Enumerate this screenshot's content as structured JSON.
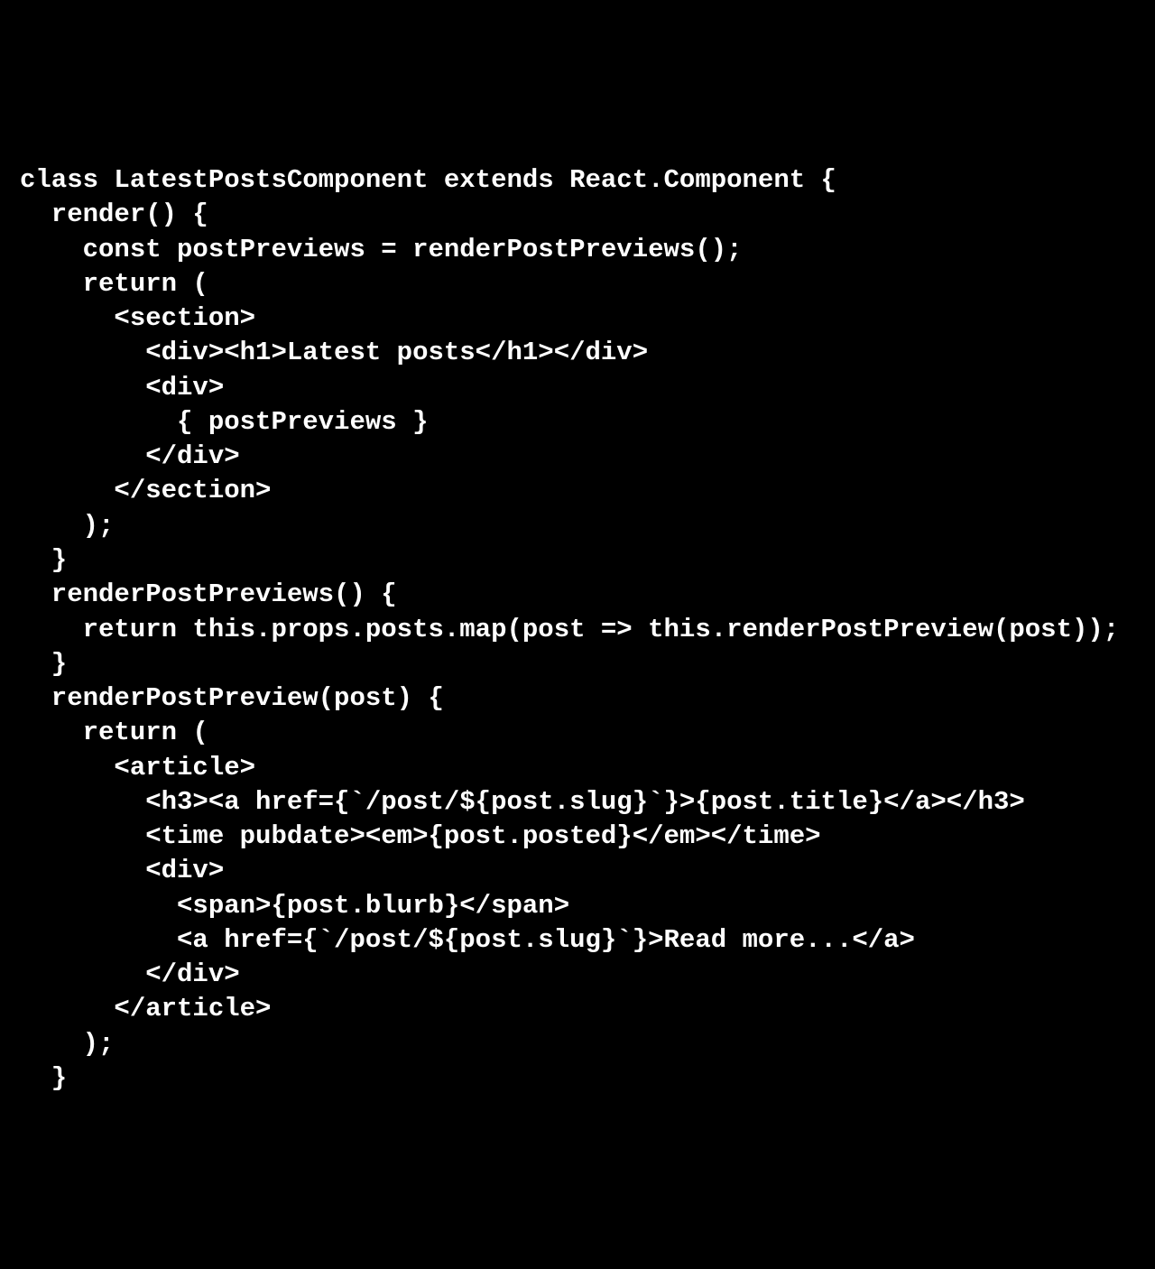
{
  "code": {
    "lines": [
      "class LatestPostsComponent extends React.Component {",
      "  render() {",
      "    const postPreviews = renderPostPreviews();",
      "    return (",
      "      <section>",
      "        <div><h1>Latest posts</h1></div>",
      "        <div>",
      "          { postPreviews }",
      "        </div>",
      "      </section>",
      "    );",
      "  }",
      "  renderPostPreviews() {",
      "    return this.props.posts.map(post => this.renderPostPreview(post));",
      "  }",
      "  renderPostPreview(post) {",
      "    return (",
      "      <article>",
      "        <h3><a href={`/post/${post.slug}`}>{post.title}</a></h3>",
      "        <time pubdate><em>{post.posted}</em></time>",
      "        <div>",
      "          <span>{post.blurb}</span>",
      "          <a href={`/post/${post.slug}`}>Read more...</a>",
      "        </div>",
      "      </article>",
      "    );",
      "  }"
    ]
  }
}
